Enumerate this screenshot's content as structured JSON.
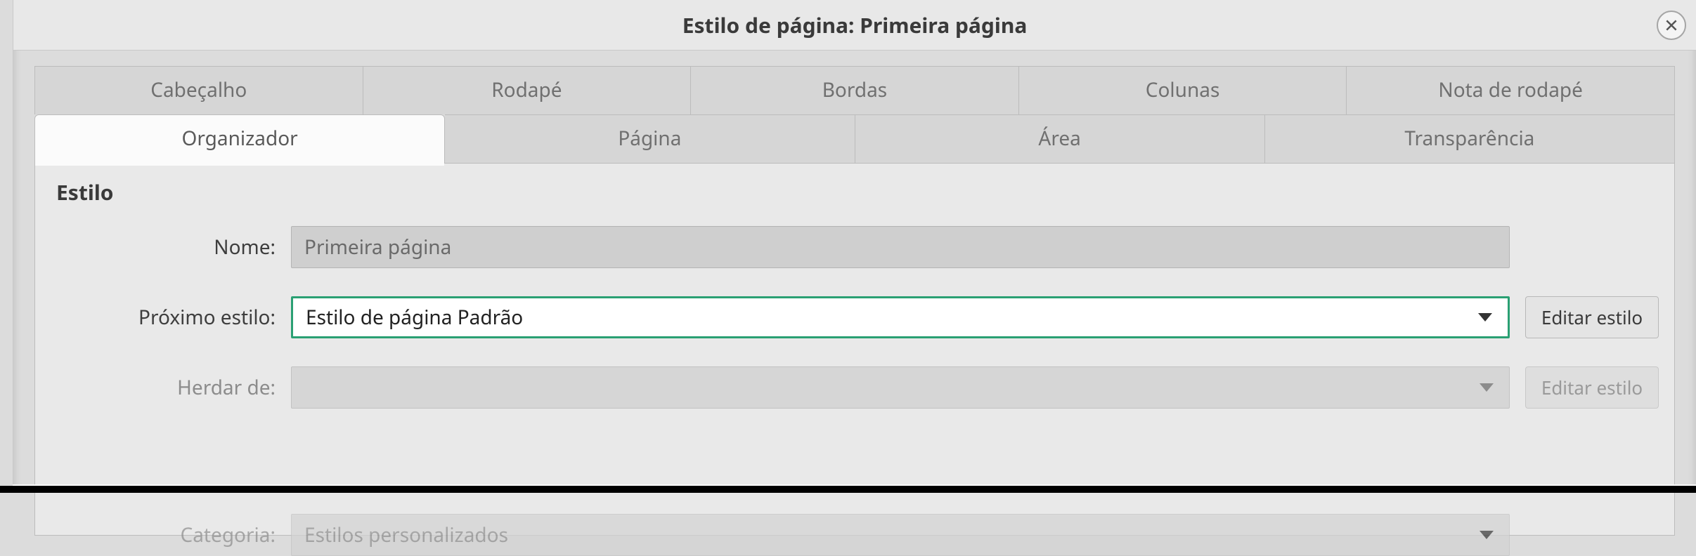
{
  "title": "Estilo de página: Primeira página",
  "tabs_top": {
    "header": "Cabeçalho",
    "footer": "Rodapé",
    "borders": "Bordas",
    "columns": "Colunas",
    "footnote": "Nota de rodapé"
  },
  "tabs_bottom": {
    "organizer": "Organizador",
    "page": "Página",
    "area": "Área",
    "transparency": "Transparência"
  },
  "section": {
    "title": "Estilo"
  },
  "form": {
    "name_label": "Nome:",
    "name_value": "Primeira página",
    "next_label": "Próximo estilo:",
    "next_value": "Estilo de página Padrão",
    "inherit_label": "Herdar de:",
    "inherit_value": "",
    "category_label": "Categoria:",
    "category_value": "Estilos personalizados",
    "edit_style": "Editar estilo"
  }
}
